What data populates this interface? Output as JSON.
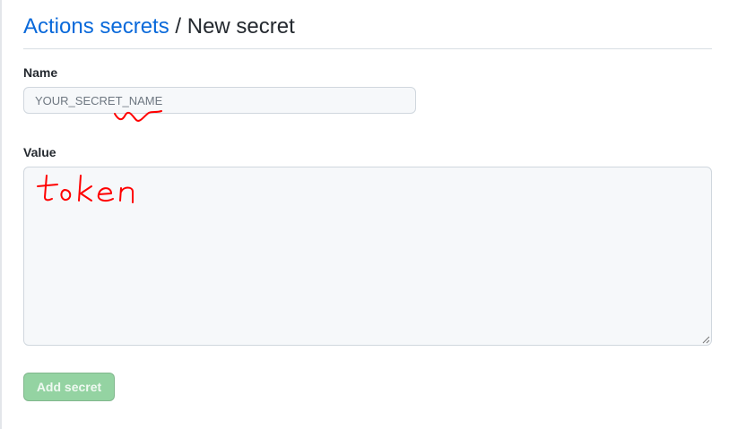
{
  "header": {
    "parent_link": "Actions secrets",
    "separator": " / ",
    "current": "New secret"
  },
  "form": {
    "name_label": "Name",
    "name_placeholder": "YOUR_SECRET_NAME",
    "name_value": "",
    "value_label": "Value",
    "value_value": "",
    "submit_label": "Add secret",
    "submit_disabled": true
  },
  "annotations": {
    "handwritten_note": "token",
    "ink_color": "#ff0000"
  },
  "colors": {
    "link": "#0969da",
    "button_bg_disabled": "#94d3a2",
    "input_bg": "#f6f8fa",
    "border": "#d0d7de"
  },
  "icons": {
    "textarea_grip": "resize-grip-icon"
  }
}
